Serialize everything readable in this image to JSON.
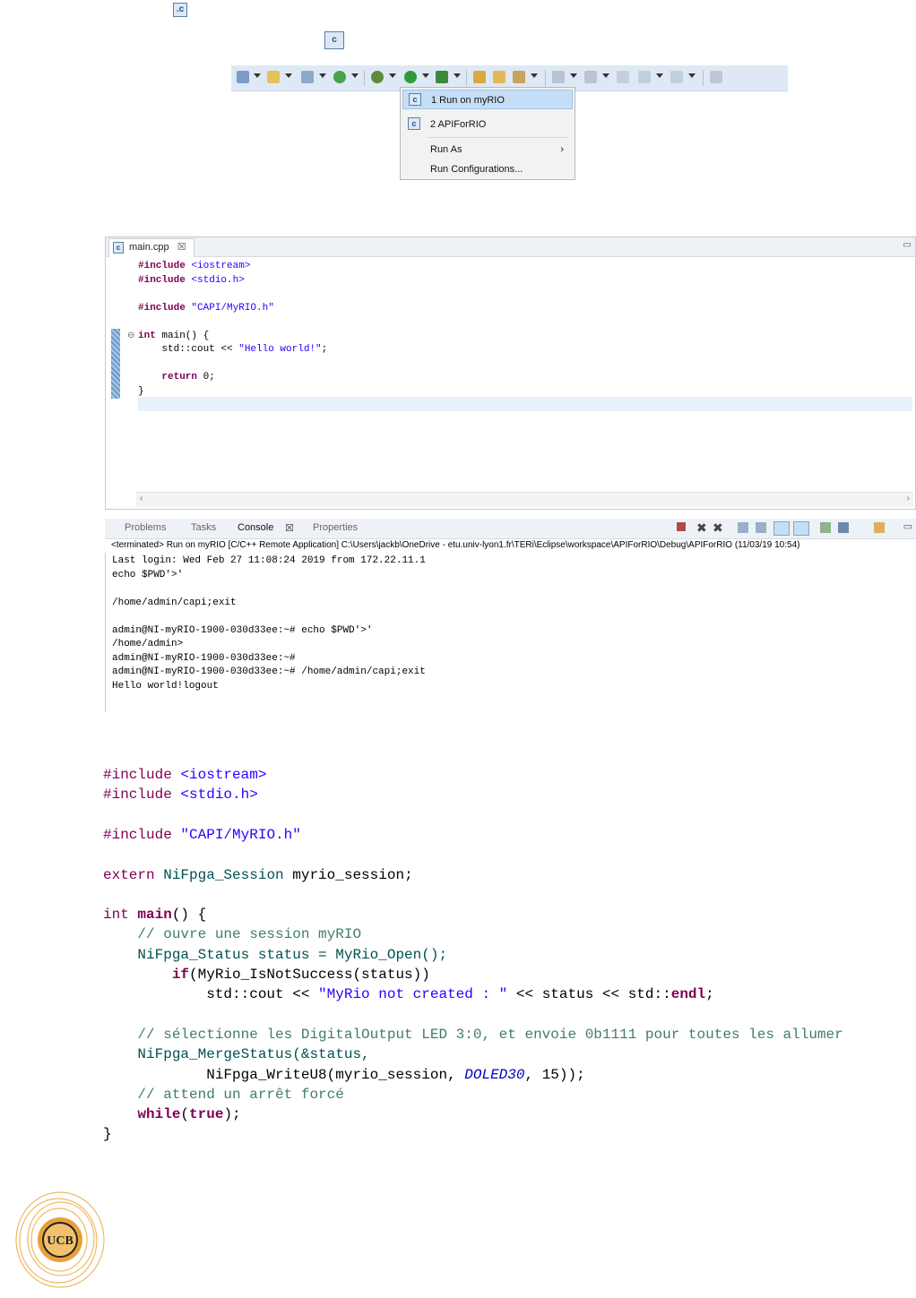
{
  "top_icons": {
    "file_icon": "c-file-icon",
    "project_icon": "c-project-icon"
  },
  "toolbar": {
    "icons": [
      "new-c-project-icon",
      "new-folder-icon",
      "new-source-icon",
      "new-class-icon",
      "debug-icon",
      "run-icon",
      "run-external-icon",
      "open-type-icon",
      "open-folder-icon",
      "search-icon",
      "edit-icon",
      "next-annotation-icon",
      "prev-annotation-icon",
      "back-icon",
      "forward-icon",
      "pin-icon"
    ]
  },
  "run_menu": {
    "items": [
      {
        "label": "1 Run on myRIO",
        "selected": true
      },
      {
        "label": "2 APIForRIO"
      },
      {
        "label": "Run As",
        "submenu": true
      },
      {
        "label": "Run Configurations..."
      }
    ]
  },
  "editor": {
    "tab_label": "main.cpp",
    "tab_close": "☒",
    "lines": [
      {
        "parts": [
          {
            "t": "#include",
            "c": "kw"
          },
          {
            "t": " <iostream>",
            "c": "str"
          }
        ]
      },
      {
        "parts": [
          {
            "t": "#include",
            "c": "kw"
          },
          {
            "t": " <stdio.h>",
            "c": "str"
          }
        ]
      },
      {
        "parts": []
      },
      {
        "parts": [
          {
            "t": "#include",
            "c": "kw"
          },
          {
            "t": " \"CAPI/MyRIO.h\"",
            "c": "str"
          }
        ]
      },
      {
        "parts": []
      },
      {
        "parts": [
          {
            "t": "int",
            "c": "kw"
          },
          {
            "t": " main() {",
            "c": ""
          }
        ]
      },
      {
        "parts": [
          {
            "t": "    std::cout << ",
            "c": ""
          },
          {
            "t": "\"Hello world!\"",
            "c": "str"
          },
          {
            "t": ";",
            "c": ""
          }
        ]
      },
      {
        "parts": []
      },
      {
        "parts": [
          {
            "t": "    ",
            "c": ""
          },
          {
            "t": "return",
            "c": "kw"
          },
          {
            "t": " 0;",
            "c": ""
          }
        ]
      },
      {
        "parts": [
          {
            "t": "}",
            "c": ""
          }
        ]
      }
    ]
  },
  "console": {
    "tabs": [
      "Problems",
      "Tasks",
      "Console",
      "Properties"
    ],
    "active_tab": "Console",
    "header": "<terminated> Run on myRIO [C/C++ Remote Application] C:\\Users\\jackb\\OneDrive - etu.univ-lyon1.fr\\TERi\\Eclipse\\workspace\\APIForRIO\\Debug\\APIForRIO (11/03/19 10:54)",
    "lines": [
      "Last login: Wed Feb 27 11:08:24 2019 from 172.22.11.1",
      "echo $PWD'>'",
      "",
      "/home/admin/capi;exit",
      "",
      "admin@NI-myRIO-1900-030d33ee:~# echo $PWD'>'",
      "/home/admin>",
      "admin@NI-myRIO-1900-030d33ee:~#",
      "admin@NI-myRIO-1900-030d33ee:~# /home/admin/capi;exit",
      "Hello world!logout"
    ]
  },
  "code_listing": {
    "lines": [
      {
        "parts": [
          {
            "t": "#include",
            "c": "bdir"
          },
          {
            "t": " ",
            "c": ""
          },
          {
            "t": "<iostream>",
            "c": "binc"
          }
        ]
      },
      {
        "parts": [
          {
            "t": "#include",
            "c": "bdir"
          },
          {
            "t": " ",
            "c": ""
          },
          {
            "t": "<stdio.h>",
            "c": "binc"
          }
        ]
      },
      {
        "parts": []
      },
      {
        "parts": [
          {
            "t": "#include",
            "c": "bdir"
          },
          {
            "t": " ",
            "c": ""
          },
          {
            "t": "\"CAPI/MyRIO.h\"",
            "c": "bstr"
          }
        ]
      },
      {
        "parts": []
      },
      {
        "parts": [
          {
            "t": "extern",
            "c": "bdir"
          },
          {
            "t": " ",
            "c": ""
          },
          {
            "t": "NiFpga_Session",
            "c": "btype"
          },
          {
            "t": " myrio_session;",
            "c": ""
          }
        ]
      },
      {
        "parts": []
      },
      {
        "parts": [
          {
            "t": "int",
            "c": "bdir"
          },
          {
            "t": " ",
            "c": ""
          },
          {
            "t": "main",
            "c": "bkw"
          },
          {
            "t": "() {",
            "c": ""
          }
        ]
      },
      {
        "parts": [
          {
            "t": "    // ouvre une session myRIO",
            "c": "bcmt"
          }
        ]
      },
      {
        "parts": [
          {
            "t": "    NiFpga_Status status = MyRio_Open();",
            "c": "btype"
          }
        ]
      },
      {
        "parts": [
          {
            "t": "        ",
            "c": ""
          },
          {
            "t": "if",
            "c": "bkw"
          },
          {
            "t": "(MyRio_IsNotSuccess(status))",
            "c": ""
          }
        ]
      },
      {
        "parts": [
          {
            "t": "            std::cout << ",
            "c": ""
          },
          {
            "t": "\"MyRio not created : \"",
            "c": "bstr"
          },
          {
            "t": " << status << std::",
            "c": ""
          },
          {
            "t": "endl",
            "c": "bkw"
          },
          {
            "t": ";",
            "c": ""
          }
        ]
      },
      {
        "parts": []
      },
      {
        "parts": [
          {
            "t": "    // sélectionne les DigitalOutput LED 3:0, et envoie 0b1111 pour toutes les allumer",
            "c": "bcmt"
          }
        ]
      },
      {
        "parts": [
          {
            "t": "    NiFpga_MergeStatus(&status,",
            "c": "btype"
          }
        ]
      },
      {
        "parts": [
          {
            "t": "            NiFpga_WriteU8(myrio_session, ",
            "c": ""
          },
          {
            "t": "DOLED30",
            "c": "bconst"
          },
          {
            "t": ", 15));",
            "c": ""
          }
        ]
      },
      {
        "parts": [
          {
            "t": "    // attend un arrêt forcé",
            "c": "bcmt"
          }
        ]
      },
      {
        "parts": [
          {
            "t": "    ",
            "c": ""
          },
          {
            "t": "while",
            "c": "bkw"
          },
          {
            "t": "(",
            "c": ""
          },
          {
            "t": "true",
            "c": "bkw"
          },
          {
            "t": ");",
            "c": ""
          }
        ]
      },
      {
        "parts": [
          {
            "t": "}",
            "c": ""
          }
        ]
      }
    ]
  },
  "logo": {
    "text": "UCB",
    "colors": [
      "#e8a13a",
      "#f3c16b",
      "#222222"
    ]
  }
}
